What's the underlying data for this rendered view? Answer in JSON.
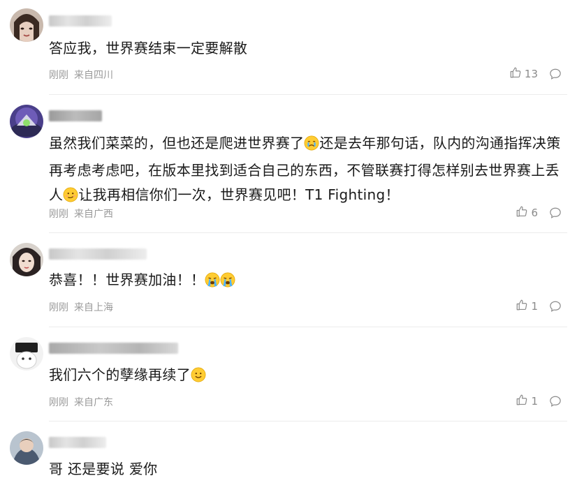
{
  "comments": [
    {
      "username_visible": "",
      "text_parts": [
        "答应我，世界赛结束一定要解散"
      ],
      "time": "刚刚",
      "location": "来自四川",
      "likes": "13"
    },
    {
      "username_visible": "",
      "text_parts": [
        "虽然我们菜菜的，但也还是爬进世界赛了",
        "还是去年那句话，队内的沟通指挥决策再考虑考虑吧，在版本里找到适合自己的东西，不管联赛打得怎样别去世界赛上丢人",
        "让我再相信你们一次，世界赛见吧！T1 Fighting！"
      ],
      "time": "刚刚",
      "location": "来自广西",
      "likes": "6"
    },
    {
      "username_visible": "",
      "text_parts": [
        "恭喜！！世界赛加油！！"
      ],
      "time": "刚刚",
      "location": "来自上海",
      "likes": "1"
    },
    {
      "username_visible": "",
      "text_parts": [
        "我们六个的孽缘再续了"
      ],
      "time": "刚刚",
      "location": "来自广东",
      "likes": "1"
    },
    {
      "username_visible": "",
      "text_parts": [
        "哥 还是要说 爱你"
      ],
      "time": "",
      "location": "",
      "likes": ""
    }
  ],
  "icons": {
    "like": "thumbs-up-icon",
    "reply": "comment-bubble-icon",
    "emoji_cry": "crying-face-emoji",
    "emoji_sob": "loudly-crying-face-emoji",
    "emoji_smile": "slightly-smiling-face-emoji",
    "emoji_heart_eyes": "smirk-face-emoji"
  },
  "colors": {
    "meta": "#9a9a9a",
    "text": "#1a1a1a",
    "divider": "#ececec"
  }
}
